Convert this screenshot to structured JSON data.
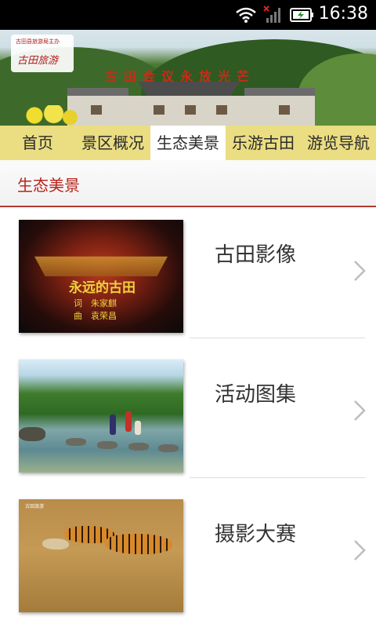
{
  "status_bar": {
    "time": "16:38",
    "icons": [
      "wifi-icon",
      "no-signal-icon",
      "battery-charging-icon"
    ]
  },
  "banner": {
    "logo_small_text": "古田县旅游局主办",
    "logo_text": "古田旅游",
    "slogan": "古田会议永放光芒"
  },
  "nav": {
    "items": [
      "首页",
      "景区概况",
      "生态美景",
      "乐游古田",
      "游览导航"
    ],
    "active_index": 2
  },
  "section": {
    "title": "生态美景"
  },
  "list": [
    {
      "label": "古田影像",
      "thumb_text": "永远的古田",
      "credit1": "词　朱家麒",
      "credit2": "曲　袁荣昌"
    },
    {
      "label": "活动图集"
    },
    {
      "label": "摄影大赛",
      "thumb_caption": "古田旅游"
    }
  ],
  "colors": {
    "accent": "#b8221a",
    "nav_bg": "#e8da78",
    "divider": "#b23a32"
  }
}
